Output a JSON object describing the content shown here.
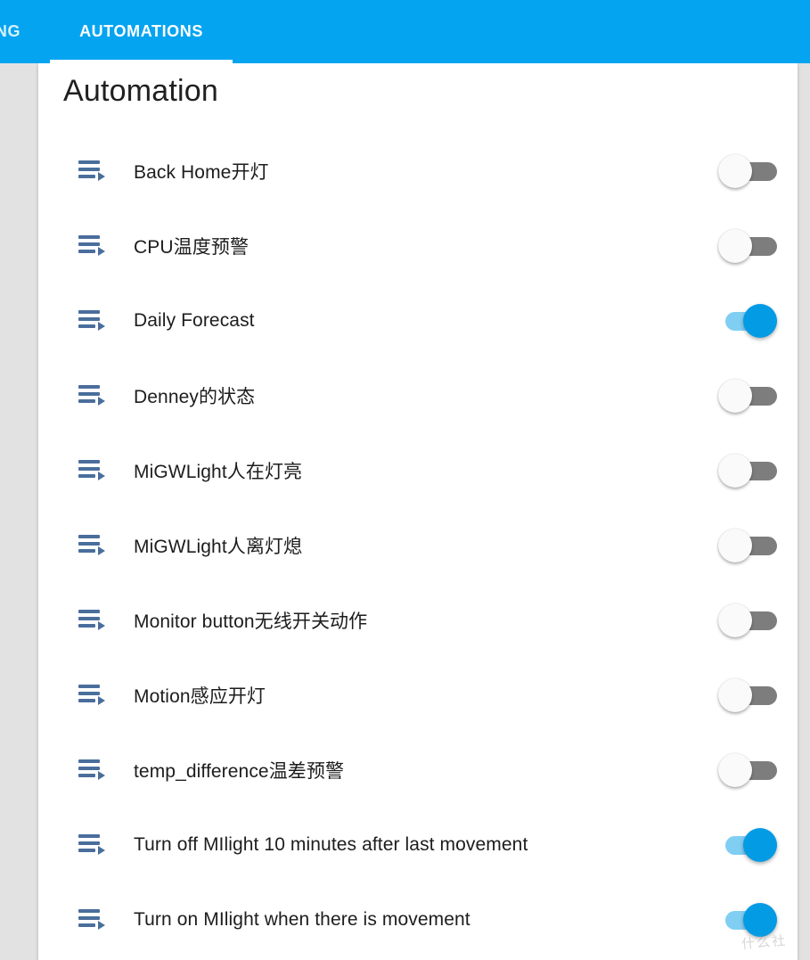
{
  "app_bar": {
    "tabs": [
      {
        "label": "TANG",
        "active": false,
        "truncated": true
      },
      {
        "label": "AUTOMATIONS",
        "active": true,
        "truncated": false
      }
    ],
    "background_color": "#05a4f0"
  },
  "page": {
    "title": "Automation",
    "card_background": "#ffffff",
    "page_background": "#e2e2e2"
  },
  "icons": {
    "automation": "playlist-play-icon",
    "automation_color": "#4a6e9c"
  },
  "toggle": {
    "on_track_color": "#81cef3",
    "on_knob_color": "#049be5",
    "off_track_color": "#7d7d7d",
    "off_knob_color": "#fafafa"
  },
  "automations": [
    {
      "name": "Back Home开灯",
      "enabled": false
    },
    {
      "name": "CPU温度预警",
      "enabled": false
    },
    {
      "name": "Daily Forecast",
      "enabled": true
    },
    {
      "name": "Denney的状态",
      "enabled": false
    },
    {
      "name": "MiGWLight人在灯亮",
      "enabled": false
    },
    {
      "name": "MiGWLight人离灯熄",
      "enabled": false
    },
    {
      "name": "Monitor button无线开关动作",
      "enabled": false
    },
    {
      "name": "Motion感应开灯",
      "enabled": false
    },
    {
      "name": "temp_difference温差预警",
      "enabled": false
    },
    {
      "name": "Turn off MIlight 10 minutes after last movement",
      "enabled": true
    },
    {
      "name": "Turn on MIlight when there is movement",
      "enabled": true
    }
  ],
  "watermark": {
    "text": "什么社"
  }
}
